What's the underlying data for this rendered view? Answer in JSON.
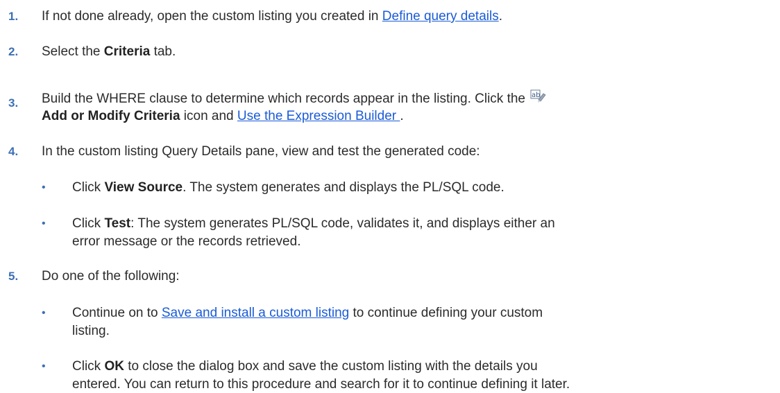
{
  "steps": [
    {
      "number": "1.",
      "before": "If not done already, open the custom listing you created in ",
      "link": "Define query details",
      "after": "."
    },
    {
      "number": "2.",
      "before": "Select the ",
      "bold": "Criteria",
      "after": " tab."
    },
    {
      "number": "3.",
      "line1": "Build the WHERE clause to determine which records appear in the listing. Click the ",
      "bold": "Add or Modify Criteria",
      "middle": " icon and ",
      "link": "Use the Expression Builder ",
      "after": ".",
      "icon": "add-modify-criteria-icon"
    },
    {
      "number": "4.",
      "text": "In the custom listing Query Details pane, view and test the generated code:",
      "bullets": [
        {
          "before": "Click ",
          "bold": "View Source",
          "after": ". The system generates and displays the PL/SQL code."
        },
        {
          "before": "Click ",
          "bold": "Test",
          "line1": ": The system generates PL/SQL code, validates it, and displays either an",
          "line2": "error message or the records retrieved."
        }
      ]
    },
    {
      "number": "5.",
      "text": "Do one of the following:",
      "bullets": [
        {
          "before": "Continue on to ",
          "link": "Save and install a custom listing",
          "line1": " to continue defining your custom",
          "line2": "listing."
        },
        {
          "before": "Click ",
          "bold": "OK",
          "line1": " to close the dialog box and save the custom listing with the details you",
          "line2": "entered. You can return to this procedure and search for it to continue defining it later."
        }
      ]
    }
  ],
  "bullet_glyph": "•",
  "colors": {
    "number": "#3d6fb5",
    "link": "#1a5bd6",
    "text": "#2b2b2b"
  }
}
